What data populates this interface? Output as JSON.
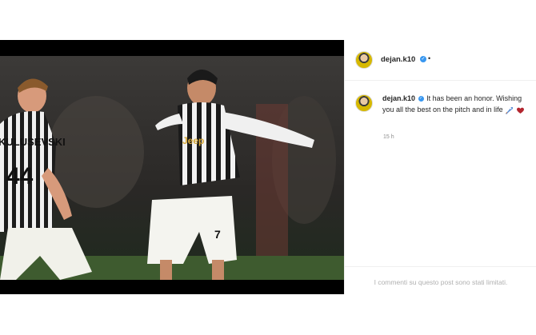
{
  "post": {
    "header": {
      "username": "dejan.k10",
      "more": "•"
    },
    "caption": {
      "username": "dejan.k10",
      "text": "It has been an honor. Wishing you all the best on the pitch and in life",
      "emojis": [
        "rocket-emoji",
        "heart-emoji"
      ]
    },
    "time": "15 h",
    "comments_limited": "I commenti su questo post sono stati limitati.",
    "photo": {
      "left_player_name": "KULUSEVSKI",
      "left_player_number": "44",
      "right_player_number": "7",
      "sponsor": "Jeep"
    }
  }
}
